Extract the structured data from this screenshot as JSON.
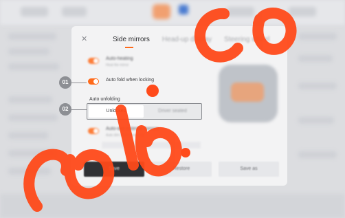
{
  "dialog": {
    "close_icon": "close-icon",
    "tabs": [
      "Side mirrors",
      "Head-up display",
      "Steering wheel"
    ],
    "active_tab": "Side mirrors",
    "blurred_items": [
      {
        "label": "Auto-heating",
        "hint": "Heat the mirror"
      },
      {
        "label": "Auto-dim exterior mirrors",
        "hint": "Auto dim when reversing"
      }
    ],
    "auto_fold": {
      "label": "Auto fold when locking",
      "enabled": true
    },
    "auto_unfolding": {
      "title": "Auto unfolding",
      "options": [
        "Unlocked",
        "Driver seated"
      ],
      "selected": "Unlocked"
    },
    "buttons": {
      "save": "Save",
      "restore": "Restore",
      "save_as": "Save as"
    }
  },
  "callouts": [
    "01",
    "02"
  ],
  "colors": {
    "accent": "#ff6a1a",
    "watermark": "#ff4a1a"
  }
}
